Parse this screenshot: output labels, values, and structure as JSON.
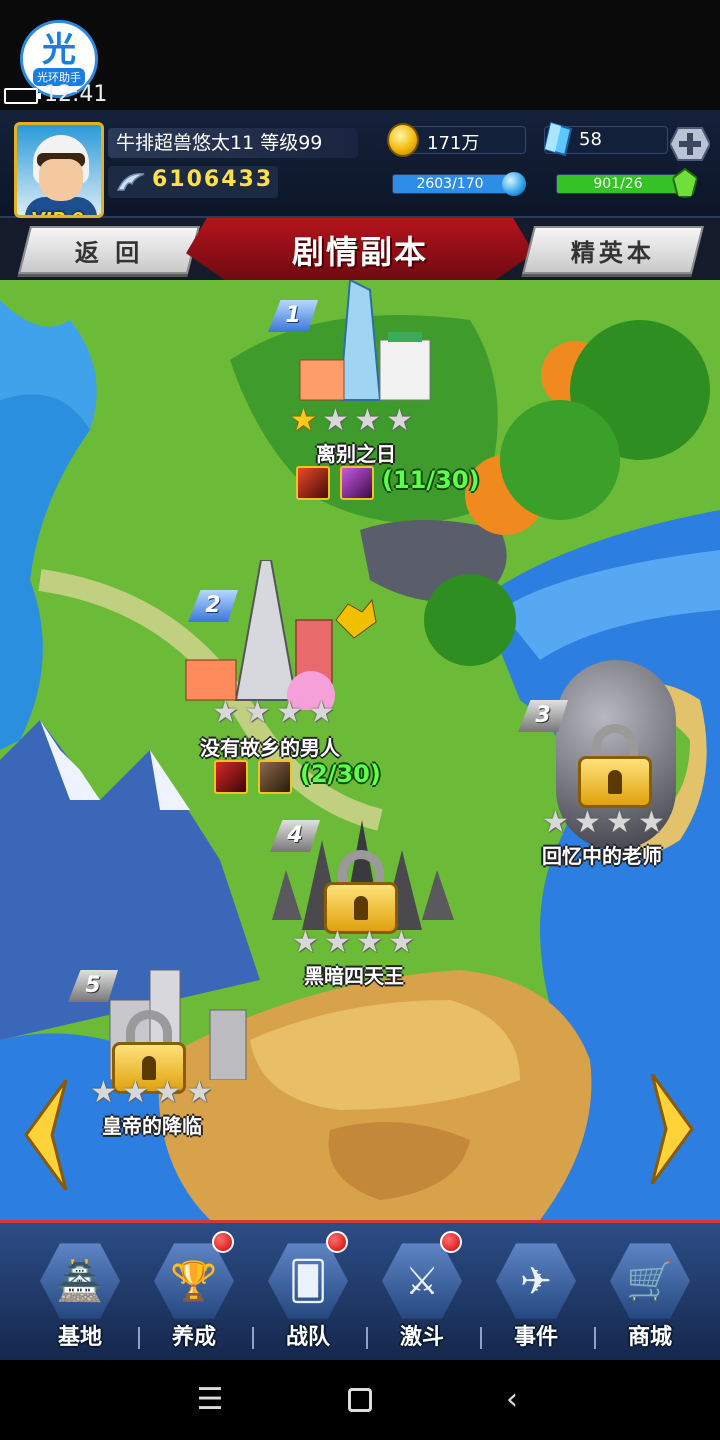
{
  "status_bar": {
    "app_badge_glyph": "光",
    "app_badge_label": "光环助手",
    "time": "12:41"
  },
  "player": {
    "name_level": "牛排超兽悠太11 等级99",
    "vip": "VIP 0",
    "power": "6106433"
  },
  "resources": {
    "coins": "171万",
    "gems": "58",
    "energy": "2603/170",
    "energy_ratio": 1.0,
    "stamina": "901/26",
    "stamina_ratio": 1.0
  },
  "header": {
    "back_label": "返 回",
    "title": "剧情副本",
    "elite_label": "精英本"
  },
  "stages": [
    {
      "num": "1",
      "name": "离别之日",
      "stars_earned": 1,
      "stars_total": 4,
      "locked": false,
      "progress": "(11/30)"
    },
    {
      "num": "2",
      "name": "没有故乡的男人",
      "stars_earned": 0,
      "stars_total": 4,
      "locked": false,
      "progress": "(2/30)"
    },
    {
      "num": "3",
      "name": "回忆中的老师",
      "stars_earned": 0,
      "stars_total": 4,
      "locked": true
    },
    {
      "num": "4",
      "name": "黑暗四天王",
      "stars_earned": 0,
      "stars_total": 4,
      "locked": true
    },
    {
      "num": "5",
      "name": "皇帝的降临",
      "stars_earned": 0,
      "stars_total": 4,
      "locked": true
    }
  ],
  "bottom_nav": [
    {
      "label": "基地",
      "icon": "base-icon",
      "badge": false
    },
    {
      "label": "养成",
      "icon": "trophy-icon",
      "badge": true
    },
    {
      "label": "战队",
      "icon": "cards-icon",
      "badge": true
    },
    {
      "label": "激斗",
      "icon": "warrior-icon",
      "badge": true
    },
    {
      "label": "事件",
      "icon": "jet-icon",
      "badge": false
    },
    {
      "label": "商城",
      "icon": "cart-icon",
      "badge": false
    }
  ],
  "colors": {
    "accent_red": "#b5131c",
    "star_gold": "#ffc81a",
    "progress_green": "#5cff4a",
    "energy_blue": "#2e8de6",
    "stamina_green": "#35c227"
  }
}
